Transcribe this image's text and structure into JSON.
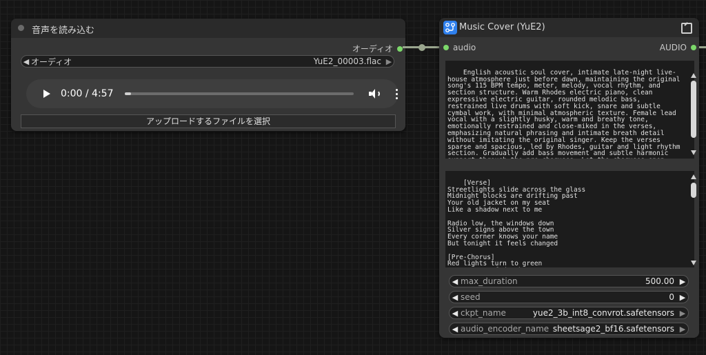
{
  "load_node": {
    "title": "音声を読み込む",
    "output_label": "オーディオ",
    "audio_combo": {
      "label": "オーディオ",
      "value": "YuE2_00003.flac"
    },
    "player": {
      "time": "0:00 / 4:57",
      "progress": 0.03
    },
    "upload_label": "アップロードするファイルを選択"
  },
  "cover_node": {
    "title": "Music Cover (YuE2)",
    "input_label": "audio",
    "output_label": "AUDIO",
    "prompt_text": "English acoustic soul cover, intimate late-night live-house atmosphere just before dawn, maintaining the original song's 115 BPM tempo, meter, melody, vocal rhythm, and section structure. Warm Rhodes electric piano, clean expressive electric guitar, rounded melodic bass, restrained live drums with soft kick, snare and subtle cymbal work, with minimal atmospheric texture. Female lead vocal with a slightly husky, warm and breathy tone, emotionally restrained and close-miked in the verses, emphasizing natural phrasing and intimate breath detail without imitating the original singer. Keep the verses sparse and spacious, led by Rhodes, guitar and light rhythm section. Gradually add bass movement and subtle harmonic support through the pre-choruses. Let the choruses open warmly with fuller live instrumentation, layered female backing harmonies, wider Rhodes voicings and gentle guitar accents while preserving the original melody and rhythmic phrasing. Pull the arrangement back again during",
    "lyrics_text": "[Verse]\nStreetlights slide across the glass\nMidnight blocks are drifting past\nYour old jacket on my seat\nLike a shadow next to me\n\nRadio low, the windows down\nSilver signs above the town\nEvery corner knows your name\nBut tonight it feels changed\n\n[Pre-Chorus]\nRed lights turn to green\nYour memory fades between\nThe places we have been",
    "widgets": [
      {
        "label": "max_duration",
        "value": "500.00"
      },
      {
        "label": "seed",
        "value": "0"
      },
      {
        "label": "ckpt_name",
        "value": "yue2_3b_int8_convrot.safetensors"
      },
      {
        "label": "audio_encoder_name",
        "value": "sheetsage2_bf16.safetensors"
      }
    ]
  },
  "icons": {
    "status": "status-dot-icon",
    "play": "play-icon",
    "volume": "volume-icon",
    "menu": "more-vert-icon",
    "app": "node-app-icon",
    "expand": "expand-icon",
    "left": "arrow-left-icon",
    "right": "arrow-right-icon"
  },
  "colors": {
    "slot": "#7cd86a",
    "link": "#9aa68e",
    "app_icon": "#2f80ed"
  }
}
